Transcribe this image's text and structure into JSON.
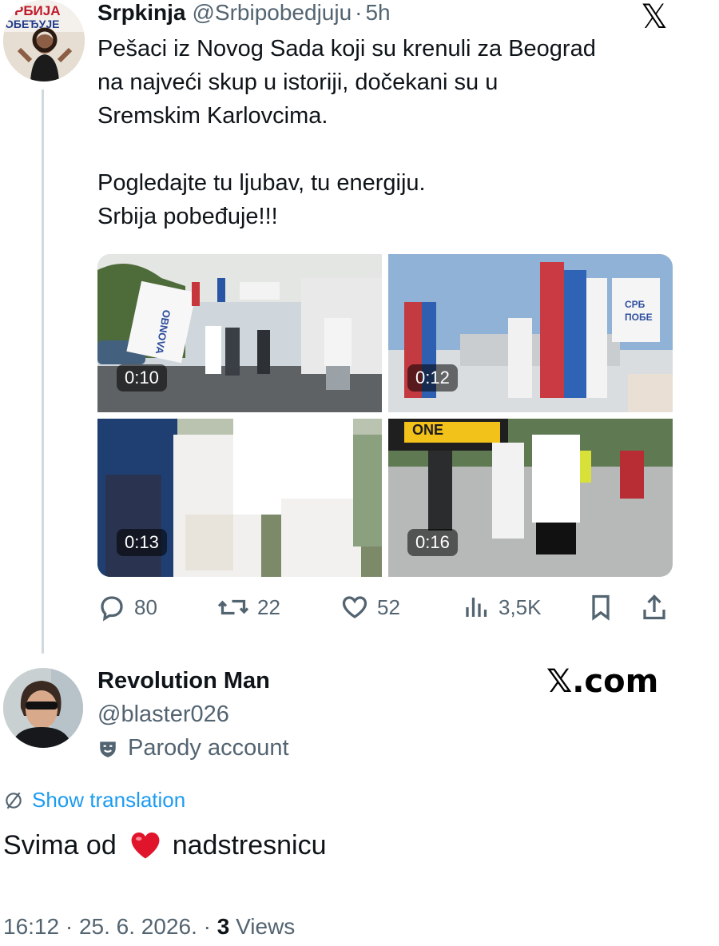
{
  "tweet": {
    "author_name": "Srpkinja",
    "author_handle": "@Srbipobedjuju",
    "time": "5h",
    "avatar_banner_line1": "РБИЈА",
    "avatar_banner_line2": "ОБЕЂУЈЕ",
    "text": "Pešaci iz Novog Sada koji su krenuli za Beograd\nna najveći skup u istoriji, dočekani su u\nSremskim Karlovcima.\n\nPogledajte tu ljubav, tu energiju.\nSrbija pobeđuje!!!",
    "videos": [
      {
        "duration": "0:10",
        "flag_text": "OBNOVA"
      },
      {
        "duration": "0:12",
        "flag_text": "СРБ ПОБЕ"
      },
      {
        "duration": "0:13"
      },
      {
        "duration": "0:16",
        "banner_text": "ONE"
      }
    ],
    "metrics": {
      "replies": "80",
      "reposts": "22",
      "likes": "52",
      "views": "3,5K"
    }
  },
  "x_logo_top": "𝕏",
  "reply": {
    "author_name": "Revolution Man",
    "author_handle": "@blaster026",
    "label": "Parody account",
    "x_com": "𝕏.com",
    "show_translation": "Show translation",
    "text_before": "Svima od",
    "emoji": "❤️",
    "text_after": "nadstresnicu",
    "time": "16:12",
    "date": "25. 6. 2026.",
    "views_count": "3",
    "views_label": "Views"
  },
  "colors": {
    "accent": "#1d9bf0",
    "muted": "#536471",
    "text": "#0f1419",
    "heart": "#e0152b"
  }
}
